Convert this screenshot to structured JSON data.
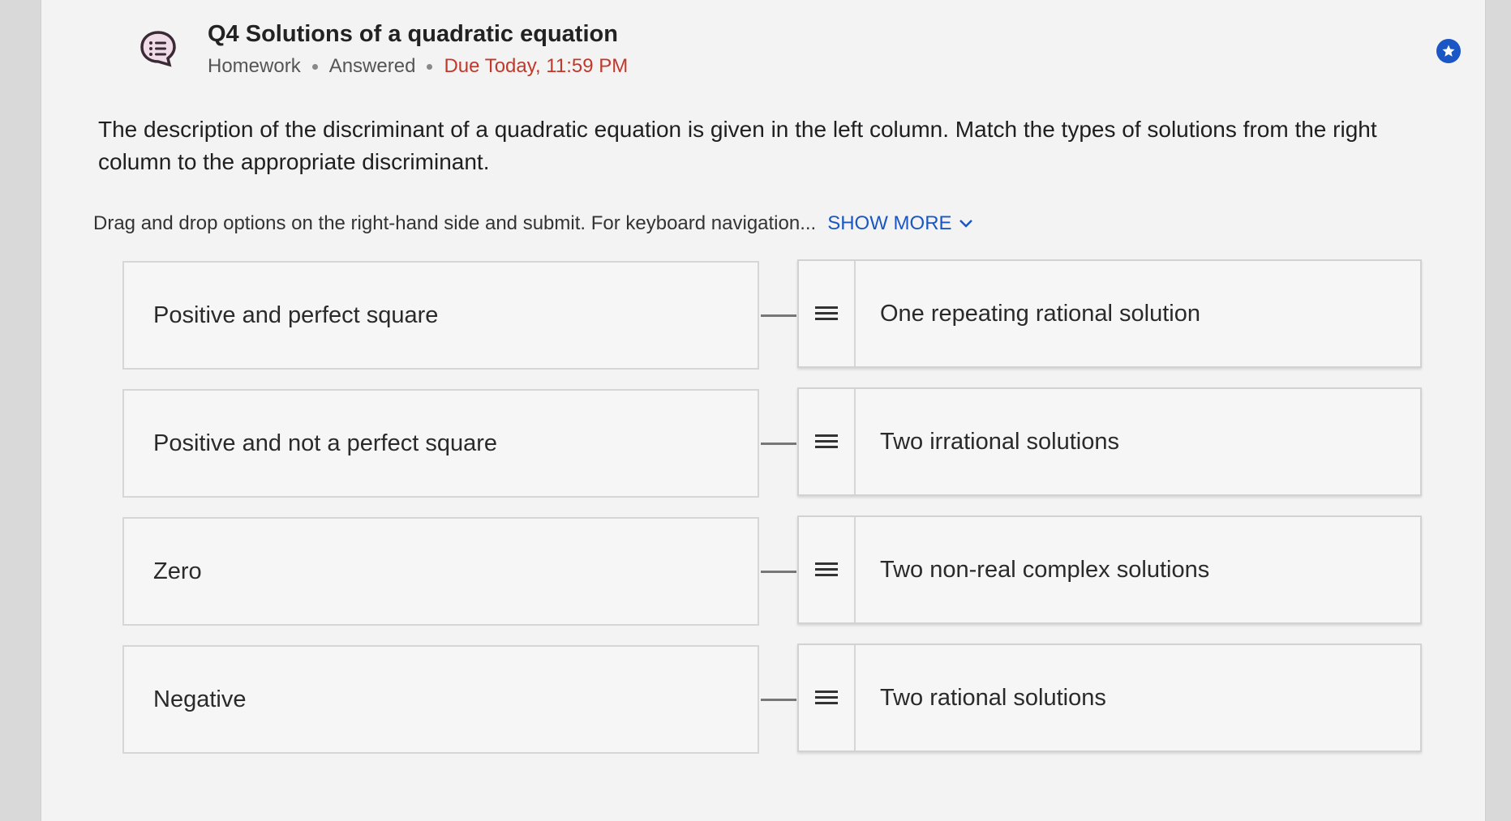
{
  "question": {
    "title": "Q4 Solutions of a quadratic equation",
    "type": "Homework",
    "status": "Answered",
    "due": "Due Today, 11:59 PM",
    "icon": "chat-list-icon",
    "star_icon": "star-icon",
    "accent_color": "#1a56c4",
    "due_color": "#c0392b"
  },
  "prompt": "The description of the discriminant of a quadratic equation is given in the left column. Match the types of solutions from the right column to the appropriate discriminant.",
  "instructions": {
    "text": "Drag and drop options on the right-hand side and submit. For keyboard navigation...",
    "show_more": "SHOW MORE"
  },
  "matches": [
    {
      "left": "Positive and perfect square",
      "right": "One repeating rational solution"
    },
    {
      "left": "Positive and not a perfect square",
      "right": "Two irrational solutions"
    },
    {
      "left": "Zero",
      "right": "Two non-real complex solutions"
    },
    {
      "left": "Negative",
      "right": "Two rational solutions"
    }
  ]
}
